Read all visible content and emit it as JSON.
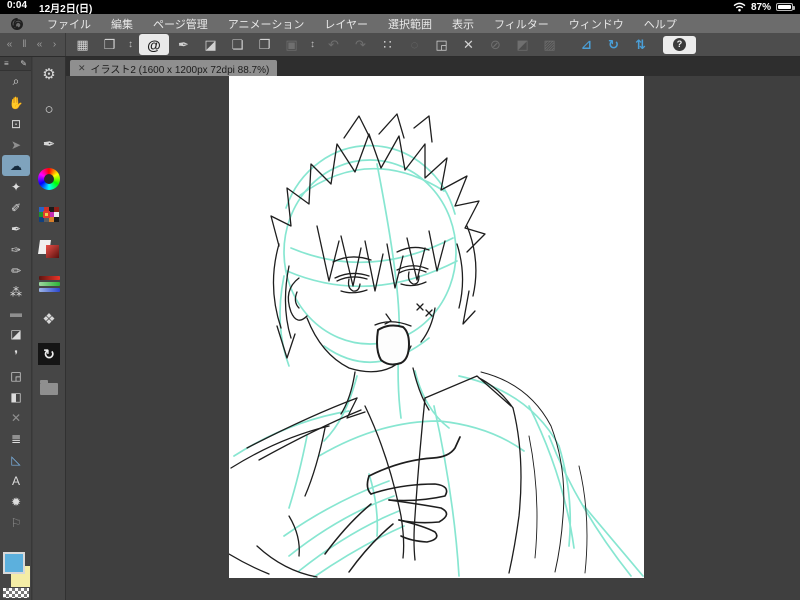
{
  "status_bar": {
    "time": "0:04",
    "date": "12月2日(日)",
    "battery_percent": "87%",
    "icons": [
      "wifi-icon",
      "battery-icon"
    ]
  },
  "menu_bar": {
    "logo_icon": "clip-studio-swirl-logo",
    "items": [
      "ファイル",
      "編集",
      "ページ管理",
      "アニメーション",
      "レイヤー",
      "選択範囲",
      "表示",
      "フィルター",
      "ウィンドウ",
      "ヘルプ"
    ]
  },
  "dock_controls": [
    {
      "name": "dock-collapse-icon",
      "glyph": "«"
    },
    {
      "name": "dock-pause-icon",
      "glyph": "‖"
    },
    {
      "name": "dock-collapse2-icon",
      "glyph": "«"
    },
    {
      "name": "dock-expand-icon",
      "glyph": "›"
    }
  ],
  "toolbar": {
    "buttons": [
      {
        "name": "tool-palette-grid-icon",
        "glyph": "▦",
        "cls": ""
      },
      {
        "name": "screen-layout-icon",
        "glyph": "❒",
        "cls": ""
      },
      {
        "name": "stepper-icon",
        "glyph": "↕",
        "cls": "narrow"
      },
      {
        "name": "clip-studio-mode-icon",
        "glyph": "@",
        "cls": "active"
      },
      {
        "name": "pen-switch-icon",
        "glyph": "✒",
        "cls": ""
      },
      {
        "name": "eraser-switch-icon",
        "glyph": "◪",
        "cls": ""
      },
      {
        "name": "new-canvas-icon",
        "glyph": "❏",
        "cls": ""
      },
      {
        "name": "open-file-icon",
        "glyph": "❐",
        "cls": ""
      },
      {
        "name": "save-icon",
        "glyph": "▣",
        "cls": "disabled"
      },
      {
        "name": "stepper-icon",
        "glyph": "↕",
        "cls": "narrow"
      },
      {
        "name": "undo-icon",
        "glyph": "↶",
        "cls": "disabled"
      },
      {
        "name": "redo-icon",
        "glyph": "↷",
        "cls": "disabled"
      },
      {
        "name": "selection-pen-icon",
        "glyph": "∷",
        "cls": ""
      },
      {
        "name": "selection-launcher-icon",
        "glyph": "◌",
        "cls": "disabled"
      },
      {
        "name": "fill-bucket-icon",
        "glyph": "◲",
        "cls": ""
      },
      {
        "name": "transform-mesh-icon",
        "glyph": "✕",
        "cls": ""
      },
      {
        "name": "clear-selection-icon",
        "glyph": "⊘",
        "cls": "disabled"
      },
      {
        "name": "mask-icon",
        "glyph": "◩",
        "cls": "disabled"
      },
      {
        "name": "frame-select-icon",
        "glyph": "▨",
        "cls": "disabled"
      },
      {
        "name": "snap-ruler-icon",
        "glyph": "⊿",
        "cls": "blue divided"
      },
      {
        "name": "rotate-view-icon",
        "glyph": "↻",
        "cls": "blue"
      },
      {
        "name": "flip-view-icon",
        "glyph": "⇅",
        "cls": "blue"
      },
      {
        "name": "help-icon",
        "glyph": "?",
        "cls": "help"
      }
    ]
  },
  "tab_bar": {
    "close_glyph": "✕",
    "title": "イラスト2 (1600 x 1200px 72dpi 88.7%)"
  },
  "tool_header": {
    "menu_glyph": "≡",
    "pen_glyph": "✎"
  },
  "tools": [
    {
      "name": "zoom-tool",
      "glyph": "⌕",
      "cls": ""
    },
    {
      "name": "move-screen-tool",
      "glyph": "✋",
      "cls": ""
    },
    {
      "name": "move-layer-tool",
      "glyph": "⊡",
      "cls": ""
    },
    {
      "name": "object-tool",
      "glyph": "➤",
      "cls": "dim"
    },
    {
      "name": "lasso-selection-tool",
      "glyph": "☁",
      "cls": "selected"
    },
    {
      "name": "auto-select-tool",
      "glyph": "✦",
      "cls": ""
    },
    {
      "name": "eyedropper-tool",
      "glyph": "✐",
      "cls": ""
    },
    {
      "name": "pen-tool",
      "glyph": "✒",
      "cls": ""
    },
    {
      "name": "brush-tool",
      "glyph": "✑",
      "cls": ""
    },
    {
      "name": "pencil-tool",
      "glyph": "✏",
      "cls": ""
    },
    {
      "name": "airbrush-tool",
      "glyph": "⁂",
      "cls": ""
    },
    {
      "name": "decoration-tool",
      "glyph": "▬",
      "cls": "dim"
    },
    {
      "name": "eraser-tool",
      "glyph": "◪",
      "cls": ""
    },
    {
      "name": "blend-tool",
      "glyph": "❜",
      "cls": ""
    },
    {
      "name": "fill-tool",
      "glyph": "◲",
      "cls": ""
    },
    {
      "name": "gradient-tool",
      "glyph": "◧",
      "cls": ""
    },
    {
      "name": "figure-tool",
      "glyph": "✕",
      "cls": "dim"
    },
    {
      "name": "frame-border-tool",
      "glyph": "≣",
      "cls": ""
    },
    {
      "name": "ruler-tool",
      "glyph": "◺",
      "cls": "blue"
    },
    {
      "name": "text-tool",
      "glyph": "A",
      "cls": ""
    },
    {
      "name": "balloon-tool",
      "glyph": "✹",
      "cls": ""
    },
    {
      "name": "correction-tool",
      "glyph": "⚐",
      "cls": "dim"
    }
  ],
  "palette_dock": {
    "tool_property_glyph": "⚙",
    "sub_tool_glyph": "○",
    "brush_size_glyph": "✒",
    "layers_glyph": "❖",
    "navigator_glyph": "↻"
  },
  "color_swatches": {
    "foreground": "#5cb0dd",
    "background": "#f4eda6"
  },
  "canvas": {
    "background": "#ffffff",
    "sketch_cyan": "#3fd7b5",
    "sketch_black": "#1e1e1e"
  }
}
